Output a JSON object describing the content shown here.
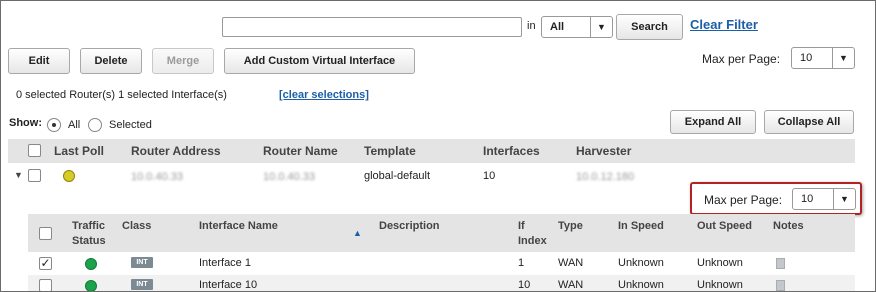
{
  "search": {
    "query_value": "",
    "in_label": "in",
    "scope_selected": "All",
    "search_button": "Search",
    "clear_filter": "Clear Filter"
  },
  "toolbar": {
    "edit": "Edit",
    "delete": "Delete",
    "merge": "Merge",
    "add_custom": "Add Custom Virtual Interface"
  },
  "max_per_page": {
    "label": "Max per Page:",
    "value": "10"
  },
  "selection": {
    "summary": "0 selected Router(s) 1 selected Interface(s)",
    "clear_link": "[clear selections]"
  },
  "show": {
    "label": "Show:",
    "options": [
      "All",
      "Selected"
    ],
    "selected": "All"
  },
  "actions": {
    "expand_all": "Expand All",
    "collapse_all": "Collapse All"
  },
  "router_table": {
    "columns": [
      "Last Poll",
      "Router Address",
      "Router Name",
      "Template",
      "Interfaces",
      "Harvester"
    ],
    "rows": [
      {
        "status_color": "#d8cc22",
        "router_address": "10.0.40.33",
        "router_name": "10.0.40.33",
        "template": "global-default",
        "interfaces": "10",
        "harvester": "10.0.12.180"
      }
    ]
  },
  "interface_table": {
    "max_per_page_label": "Max per Page:",
    "max_per_page_value": "10",
    "highlight_color": "#b22222",
    "columns": {
      "traffic_status": [
        "Traffic",
        "Status"
      ],
      "class": "Class",
      "interface_name": "Interface Name",
      "description": "Description",
      "if_index": [
        "If",
        "Index"
      ],
      "type": "Type",
      "in_speed": "In Speed",
      "out_speed": "Out Speed",
      "notes": "Notes"
    },
    "sort_icon": "sort-ascending-icon",
    "rows": [
      {
        "checked": true,
        "status_color": "#1aa34a",
        "class": "INT",
        "interface_name": "Interface 1",
        "description": "",
        "if_index": "1",
        "type": "WAN",
        "in_speed": "Unknown",
        "out_speed": "Unknown",
        "notes_icon": "note-icon"
      },
      {
        "checked": false,
        "status_color": "#1aa34a",
        "class": "INT",
        "interface_name": "Interface 10",
        "description": "",
        "if_index": "10",
        "type": "WAN",
        "in_speed": "Unknown",
        "out_speed": "Unknown",
        "notes_icon": "note-icon"
      }
    ]
  }
}
